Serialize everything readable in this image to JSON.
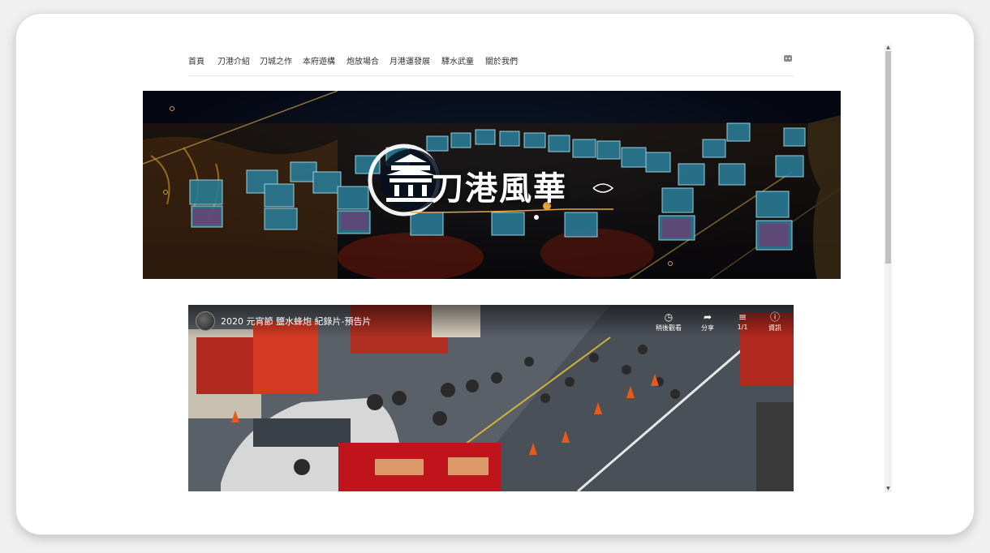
{
  "nav": {
    "items": [
      {
        "label": "首頁"
      },
      {
        "label": "刀港介紹"
      },
      {
        "label": "刀城之作"
      },
      {
        "label": "本府遊構"
      },
      {
        "label": "炮放場合"
      },
      {
        "label": "月港運發展"
      },
      {
        "label": "驛水武童"
      },
      {
        "label": "關於我們"
      }
    ],
    "icon": "share-icon"
  },
  "banner": {
    "logo_text": "刀港風華"
  },
  "video": {
    "title": "2020 元宵節 鹽水蜂炮 紀錄片-預告片",
    "controls": [
      {
        "label": "稍後觀看",
        "icon": "clock-icon"
      },
      {
        "label": "分享",
        "icon": "share-arrow-icon"
      },
      {
        "label": "1/1",
        "icon": "playlist-icon"
      },
      {
        "label": "資訊",
        "icon": "info-icon"
      }
    ]
  }
}
